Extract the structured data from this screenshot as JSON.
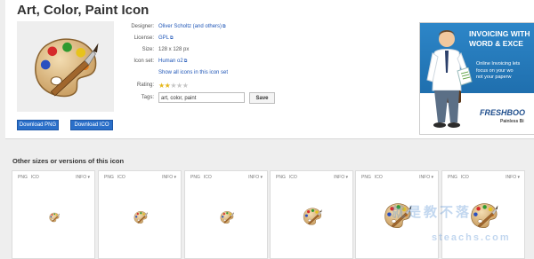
{
  "page": {
    "title": "Art, Color, Paint Icon"
  },
  "downloads": {
    "png_label": "Download PNG",
    "ico_label": "Download ICO"
  },
  "meta": {
    "designer_label": "Designer:",
    "designer_value": "Oliver Scholtz (and others)",
    "license_label": "License:",
    "license_value": "GPL",
    "size_label": "Size:",
    "size_value": "128 x 128 px",
    "iconset_label": "Icon set:",
    "iconset_value": "Human o2",
    "show_all_link": "Show all icons in this icon set",
    "rating_label": "Rating:",
    "rating_value": 2,
    "rating_max": 5,
    "tags_label": "Tags:",
    "tags_value": "art, color, paint",
    "save_label": "Save"
  },
  "ad": {
    "headline_1": "INVOICING WITH",
    "headline_2": "WORD & EXCE",
    "body_1": "Online Invoicing lets",
    "body_2": "focus on your wo",
    "body_3": "not your paperw",
    "logo": "FRESHBOO",
    "tagline": "Painless Bi",
    "colors": {
      "blue": "#2d86c8",
      "logo": "#1f4e8c"
    }
  },
  "sizes": {
    "title": "Other sizes or versions of this icon",
    "cards": [
      {
        "png": "PNG",
        "ico": "ICO",
        "info": "INFO ▾"
      },
      {
        "png": "PNG",
        "ico": "ICO",
        "info": "INFO ▾"
      },
      {
        "png": "PNG",
        "ico": "ICO",
        "info": "INFO ▾"
      },
      {
        "png": "PNG",
        "ico": "ICO",
        "info": "INFO ▾"
      },
      {
        "png": "PNG",
        "ico": "ICO",
        "info": "INFO ▾"
      },
      {
        "png": "PNG",
        "ico": "ICO",
        "info": "INFO ▾"
      }
    ]
  },
  "watermark": {
    "text": "就是教不落",
    "url": "steachs.com"
  },
  "icons": {
    "palette": "paint-palette-icon",
    "external": "external-link-icon",
    "star": "star-icon"
  },
  "colors": {
    "link": "#1f56b7",
    "button": "#2a6fc9",
    "star_on": "#e6b81c",
    "star_off": "#c6c6c6"
  }
}
